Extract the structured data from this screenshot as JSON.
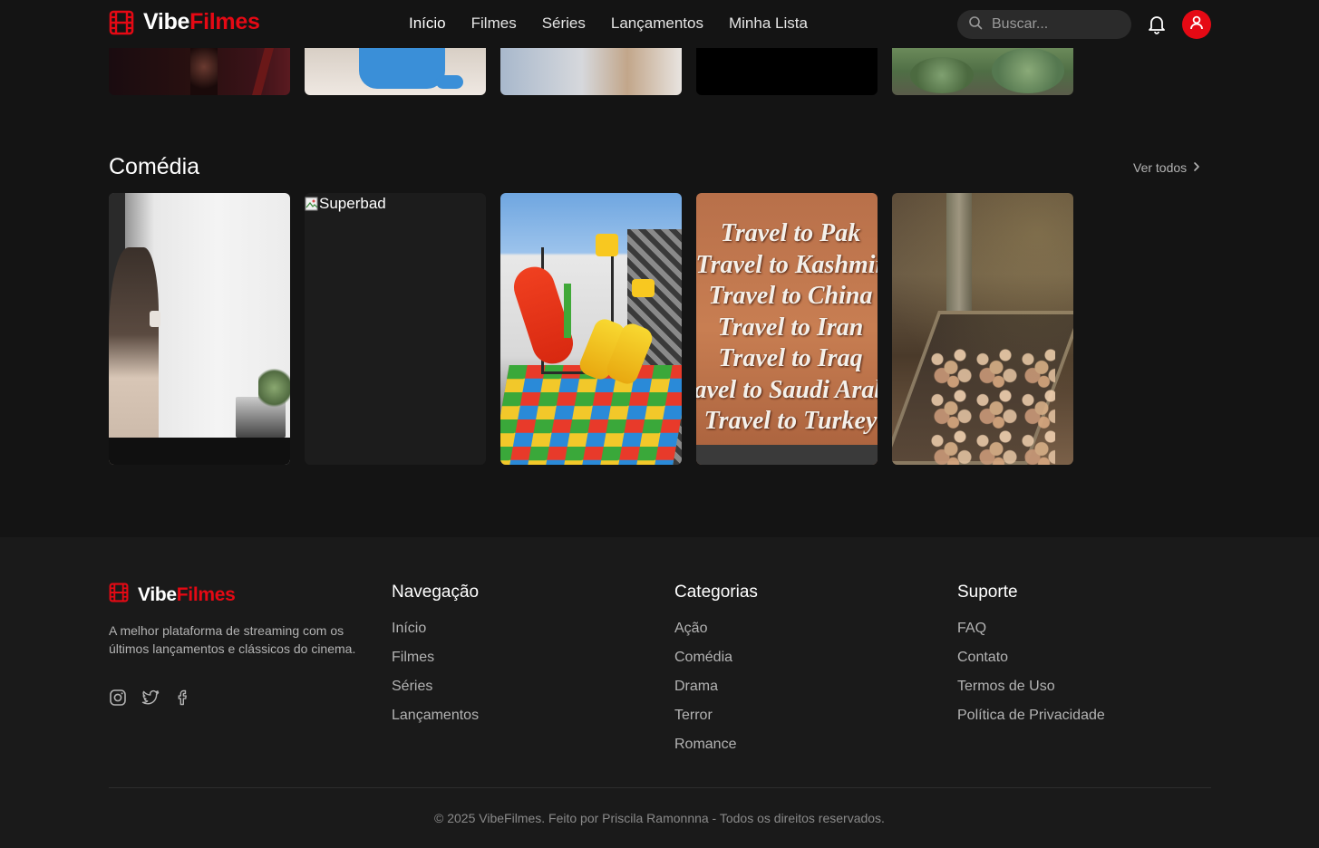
{
  "header": {
    "logo": {
      "part1": "Vibe",
      "part2": "Filmes"
    },
    "nav": [
      {
        "label": "Início",
        "active": true
      },
      {
        "label": "Filmes"
      },
      {
        "label": "Séries"
      },
      {
        "label": "Lançamentos"
      },
      {
        "label": "Minha Lista"
      }
    ],
    "search": {
      "placeholder": "Buscar..."
    },
    "icons": {
      "search": "search-icon",
      "notifications": "bell-icon",
      "profile": "user-icon"
    }
  },
  "section": {
    "title": "Comédia",
    "see_all": "Ver todos",
    "posters": [
      {
        "alt": "",
        "scene": "woman at laptop with coffee"
      },
      {
        "alt": "Superbad",
        "broken": true
      },
      {
        "alt": "",
        "scene": "colorful playground slides"
      },
      {
        "alt": "",
        "scene": "Travel to Pak / Travel to Kashmir / Travel to China / Travel to Iran / Travel to Iraq / Travel to Saudi Arabia / Travel to Turkey"
      },
      {
        "alt": "",
        "scene": "old wooden trough with autumn leaves"
      }
    ]
  },
  "footer": {
    "logo": {
      "part1": "Vibe",
      "part2": "Filmes"
    },
    "description": "A melhor plataforma de streaming com os últimos lançamentos e clássicos do cinema.",
    "socials": [
      "instagram-icon",
      "twitter-icon",
      "facebook-icon"
    ],
    "columns": [
      {
        "title": "Navegação",
        "links": [
          "Início",
          "Filmes",
          "Séries",
          "Lançamentos"
        ]
      },
      {
        "title": "Categorias",
        "links": [
          "Ação",
          "Comédia",
          "Drama",
          "Terror",
          "Romance"
        ]
      },
      {
        "title": "Suporte",
        "links": [
          "FAQ",
          "Contato",
          "Termos de Uso",
          "Política de Privacidade"
        ]
      }
    ],
    "copyright": "© 2025 VibeFilmes. Feito por Priscila Ramonnna - Todos os direitos reservados."
  },
  "travel_lines": [
    "Travel to Pak",
    "Travel to Kashmir",
    "Travel to China",
    "Travel to Iran",
    "Travel to Iraq",
    "avel to Saudi Arab",
    "Travel to Turkey"
  ],
  "colors": {
    "accent": "#e50914",
    "background": "#141414",
    "footer": "#1a1a1a"
  }
}
